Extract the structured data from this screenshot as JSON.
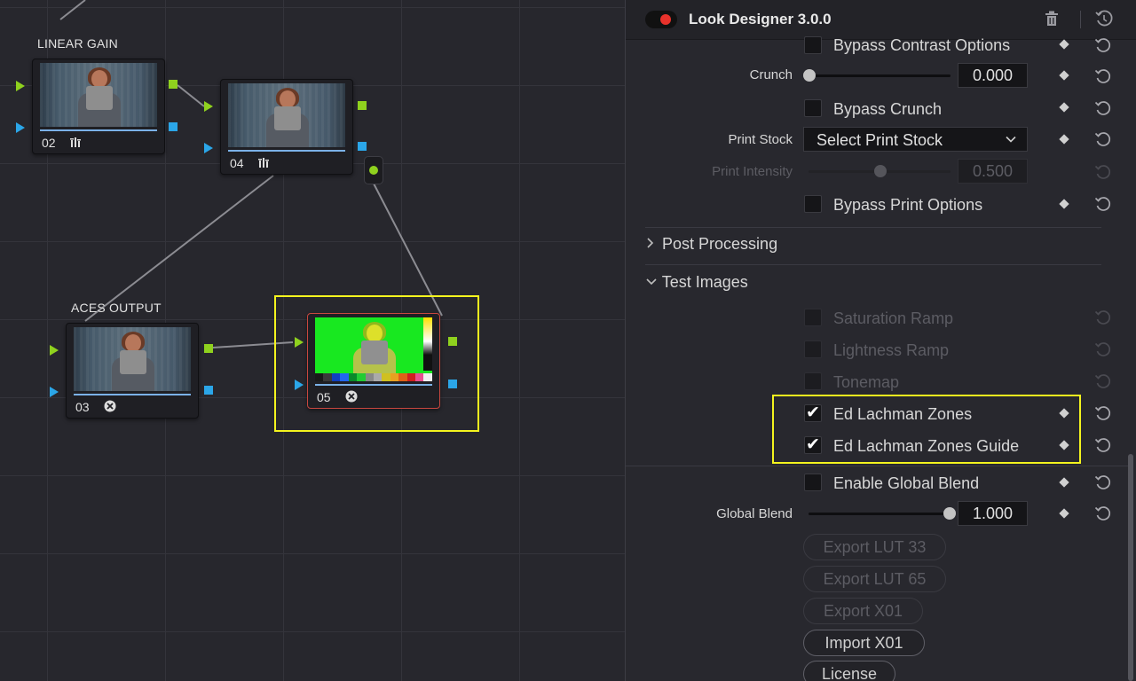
{
  "graph": {
    "nodes": [
      {
        "id": "02",
        "label": "LINEAR GAIN",
        "icon": "bars-icon"
      },
      {
        "id": "04",
        "label": "",
        "icon": "bars-icon"
      },
      {
        "id": "03",
        "label": "ACES OUTPUT",
        "icon": "aces-icon"
      },
      {
        "id": "05",
        "label": "",
        "icon": "aces-icon"
      }
    ],
    "colors": {
      "output_port": "#8fd11e",
      "key_port": "#2ba6e8",
      "selected_border": "#c8473f",
      "highlight": "#f4f41e"
    }
  },
  "panel": {
    "title": "Look Designer 3.0.0",
    "rows": {
      "bypass_contrast": "Bypass Contrast Options",
      "crunch_label": "Crunch",
      "crunch_value": "0.000",
      "bypass_crunch": "Bypass Crunch",
      "print_stock_label": "Print Stock",
      "print_stock_value": "Select Print Stock",
      "print_intensity_label": "Print Intensity",
      "print_intensity_value": "0.500",
      "bypass_print": "Bypass Print Options",
      "post_processing": "Post Processing",
      "test_images": "Test Images",
      "saturation_ramp": "Saturation Ramp",
      "lightness_ramp": "Lightness Ramp",
      "tonemap": "Tonemap",
      "ed_lachman_zones": "Ed Lachman Zones",
      "ed_lachman_zones_guide": "Ed Lachman Zones Guide",
      "enable_global_blend": "Enable Global Blend",
      "global_blend_label": "Global Blend",
      "global_blend_value": "1.000"
    },
    "levels": {
      "crunch": 0.0,
      "print_intensity": 0.5,
      "global_blend": 1.0
    },
    "checked": {
      "ed_lachman_zones": true,
      "ed_lachman_zones_guide": true
    },
    "buttons": {
      "export_lut_33": "Export LUT 33",
      "export_lut_65": "Export LUT 65",
      "export_x01": "Export X01",
      "import_x01": "Import X01",
      "license": "License"
    }
  }
}
